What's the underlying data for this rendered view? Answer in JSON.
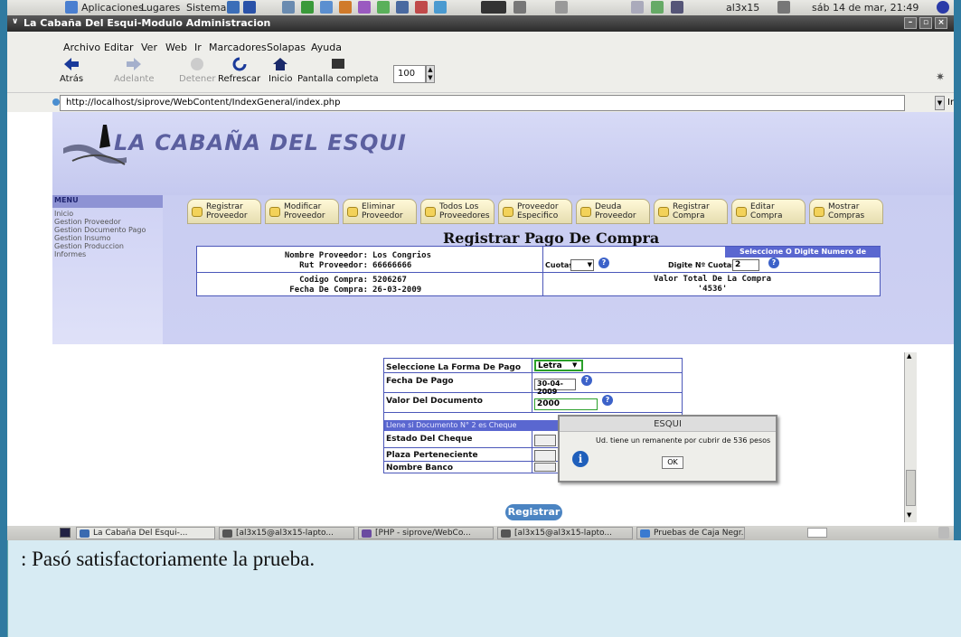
{
  "gnome_panel": {
    "menus": [
      "Aplicaciones",
      "Lugares",
      "Sistema"
    ],
    "user": "al3x15",
    "clock": "sáb 14 de mar, 21:49"
  },
  "window": {
    "title": "La Cabaña Del Esqui-Modulo Administracion"
  },
  "menubar": [
    "Archivo",
    "Editar",
    "Ver",
    "Web",
    "Ir",
    "Marcadores",
    "Solapas",
    "Ayuda"
  ],
  "toolbar": {
    "back": "Atrás",
    "forward": "Adelante",
    "stop": "Detener",
    "reload": "Refrescar",
    "home": "Inicio",
    "fullscreen": "Pantalla completa",
    "zoom": "100"
  },
  "urlbar": {
    "url": "http://localhost/siprove/WebContent/IndexGeneral/index.php",
    "go": "Ir"
  },
  "site": {
    "logo": "LA CABAÑA DEL ESQUI",
    "menu_title": "MENU",
    "menu_items": [
      "Inicio",
      "Gestion Proveedor",
      "Gestion Documento Pago",
      "Gestion Insumo",
      "Gestion Produccion",
      "Informes"
    ],
    "tabs": [
      [
        "Registrar",
        "Proveedor"
      ],
      [
        "Modificar",
        "Proveedor"
      ],
      [
        "Eliminar",
        "Proveedor"
      ],
      [
        "Todos Los",
        "Proveedores"
      ],
      [
        "Proveedor",
        "Especifico"
      ],
      [
        "Deuda",
        "Proveedor"
      ],
      [
        "Registrar",
        "Compra"
      ],
      [
        "Editar",
        "Compra"
      ],
      [
        "Mostrar",
        "Compras"
      ]
    ],
    "page_title": "Registrar Pago De Compra"
  },
  "purchase": {
    "nombre_label": "Nombre Proveedor:",
    "nombre_value": "Los Congrios",
    "rut_label": "Rut Proveedor:",
    "rut_value": "66666666",
    "codigo_label": "Codigo Compra:",
    "codigo_value": "5206267",
    "fecha_label": "Fecha De Compra:",
    "fecha_value": "26-03-2009",
    "cuotas_header": "Seleccione O Digite Numero de Cuotas",
    "cuotas_label": "Cuotas",
    "digite_label": "Digite Nº Cuotas",
    "digite_value": "2",
    "valor_total_label": "Valor Total De La Compra",
    "valor_total_value": "'4536'"
  },
  "payment": {
    "forma_label": "Seleccione La Forma De Pago",
    "forma_value": "Letra",
    "fecha_pago_label": "Fecha De Pago",
    "fecha_pago_value": "30-04-2009",
    "valor_doc_label": "Valor Del Documento",
    "valor_doc_value": "2000",
    "cheque_header": "Llene si Documento N° 2 es Cheque",
    "estado_label": "Estado Del Cheque",
    "plaza_label": "Plaza Perteneciente",
    "banco_label": "Nombre Banco",
    "register": "Registrar"
  },
  "dialog": {
    "title": "ESQUI",
    "message": "Ud. tiene un remanente por cubrir de 536 pesos",
    "ok": "OK"
  },
  "taskbar": {
    "items": [
      "La Cabaña Del Esqui-...",
      "[al3x15@al3x15-lapto...",
      "[PHP - siprove/WebCo...",
      "[al3x15@al3x15-lapto...",
      "Pruebas de Caja Negr..."
    ]
  },
  "caption": ":   Pasó satisfactoriamente la prueba.",
  "colors": {
    "border": "#2f7aa0",
    "caption_bg": "#d7ebf3",
    "banner": "#c9cdf1",
    "table_header": "#5a67d0"
  }
}
